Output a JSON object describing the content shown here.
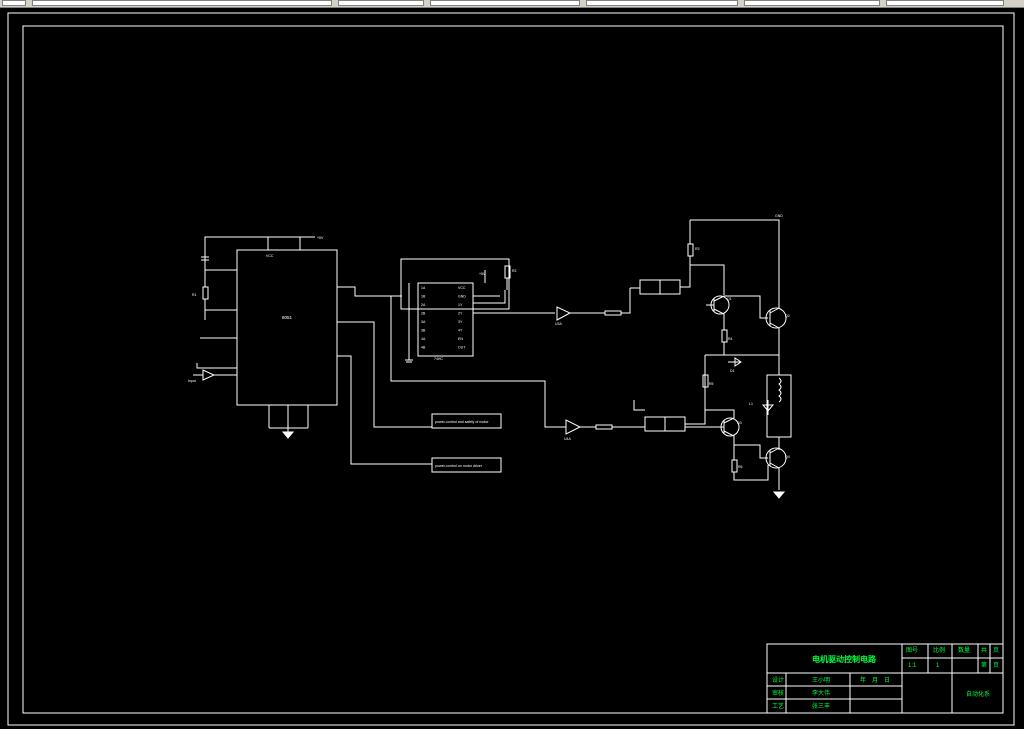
{
  "app": {
    "name": "CAD viewer",
    "background_color": "#000000",
    "line_color": "#ffffff",
    "title_text_color": "#00ff44"
  },
  "toolbar": {
    "cells": [
      "",
      "",
      "",
      "",
      "",
      "",
      ""
    ]
  },
  "schematic": {
    "ic_main": {
      "label": "8051",
      "vcc": "VCC",
      "top_pin": "+5V"
    },
    "ic_driver": {
      "label": "74HC",
      "pins_left": [
        "1A",
        "1B",
        "2A",
        "2B",
        "3A",
        "3B",
        "4A",
        "4B"
      ],
      "pins_right": [
        "VCC",
        "GND",
        "1Y",
        "2Y",
        "3Y",
        "4Y",
        "EN",
        "OUT"
      ]
    },
    "text_box_1": "power-control and safety  of motor",
    "text_box_2": "power-control  on  motor  driver",
    "input_label": "Input",
    "q_labels": [
      "Q1",
      "Q2",
      "Q3",
      "Q4"
    ],
    "resistor_labels": [
      "R1",
      "R2",
      "R3",
      "R4",
      "R5",
      "R6"
    ],
    "buffer_labels": [
      "U3A",
      "U4A"
    ],
    "misc_labels": [
      "+5V",
      "D1",
      "L1",
      "GND"
    ]
  },
  "title_block": {
    "drawing_title": "电机驱动控制电路",
    "row_labels": [
      "设计",
      "审核",
      "工艺"
    ],
    "row_values": [
      "王小明",
      "李大伟",
      "张三丰"
    ],
    "mid_values": [
      "年",
      "月",
      "日"
    ],
    "head_cells": [
      "图号",
      "比例",
      "数量",
      "共",
      "页"
    ],
    "head_values": [
      "1:1",
      "1",
      "第",
      "页"
    ],
    "company": "自动化系"
  }
}
